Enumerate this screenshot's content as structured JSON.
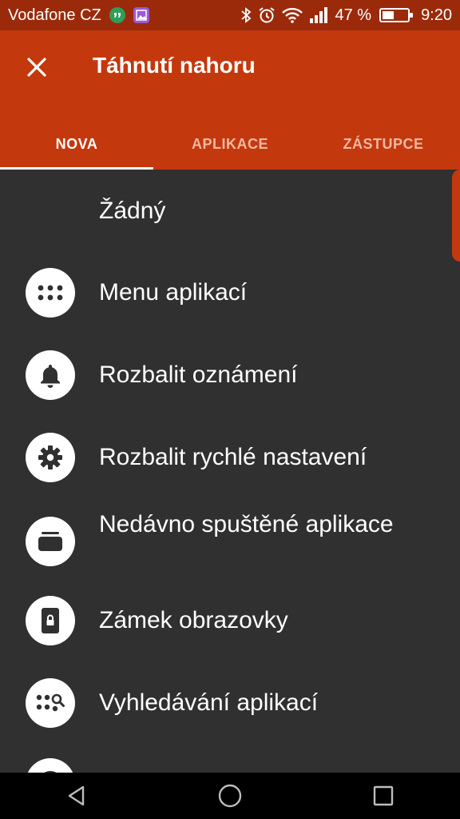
{
  "status_bar": {
    "carrier": "Vodafone CZ",
    "battery_percent": "47 %",
    "battery_level": 0.47,
    "time": "9:20",
    "icons": [
      "hangouts-icon",
      "gallery-icon",
      "bluetooth-icon",
      "alarm-icon",
      "wifi-icon",
      "signal-icon",
      "battery-icon"
    ]
  },
  "app_bar": {
    "title": "Táhnutí nahoru",
    "close_icon": "close-icon",
    "color": "#c4380d"
  },
  "tabs": [
    {
      "label": "NOVA",
      "active": true
    },
    {
      "label": "APLIKACE",
      "active": false
    },
    {
      "label": "ZÁSTUPCE",
      "active": false
    }
  ],
  "list": {
    "items": [
      {
        "label": "Žádný",
        "icon": ""
      },
      {
        "label": "Menu aplikací",
        "icon": "app-drawer-icon"
      },
      {
        "label": "Rozbalit oznámení",
        "icon": "bell-icon"
      },
      {
        "label": "Rozbalit rychlé nastavení",
        "icon": "gear-icon"
      },
      {
        "label": "Nedávno spuštěné aplikace",
        "icon": "recent-apps-icon"
      },
      {
        "label": "Zámek obrazovky",
        "icon": "lock-phone-icon"
      },
      {
        "label": "Vyhledávání aplikací",
        "icon": "app-search-icon"
      },
      {
        "label": "",
        "icon": "partial-icon"
      }
    ]
  },
  "nav_bar": {
    "icons": [
      "back-icon",
      "home-icon",
      "recents-icon"
    ]
  }
}
